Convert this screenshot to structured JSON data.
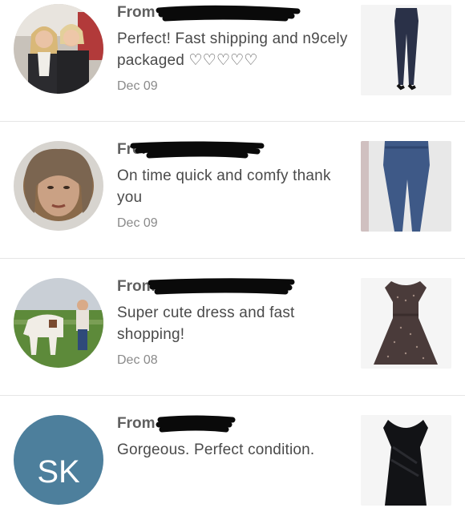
{
  "reviews": [
    {
      "from_label": "From",
      "message": "Perfect! Fast shipping and n9cely packaged ♡♡♡♡♡",
      "date": "Dec 09",
      "avatar_type": "photo"
    },
    {
      "from_label": "From",
      "message": "On time quick and comfy thank you",
      "date": "Dec 09",
      "avatar_type": "photo"
    },
    {
      "from_label": "From",
      "message": "Super cute dress and fast shopping!",
      "date": "Dec 08",
      "avatar_type": "photo"
    },
    {
      "from_label": "From",
      "message": "Gorgeous. Perfect condition.",
      "date": "",
      "avatar_type": "initials",
      "avatar_initials": "SK",
      "avatar_color": "#4d7f9c"
    }
  ]
}
